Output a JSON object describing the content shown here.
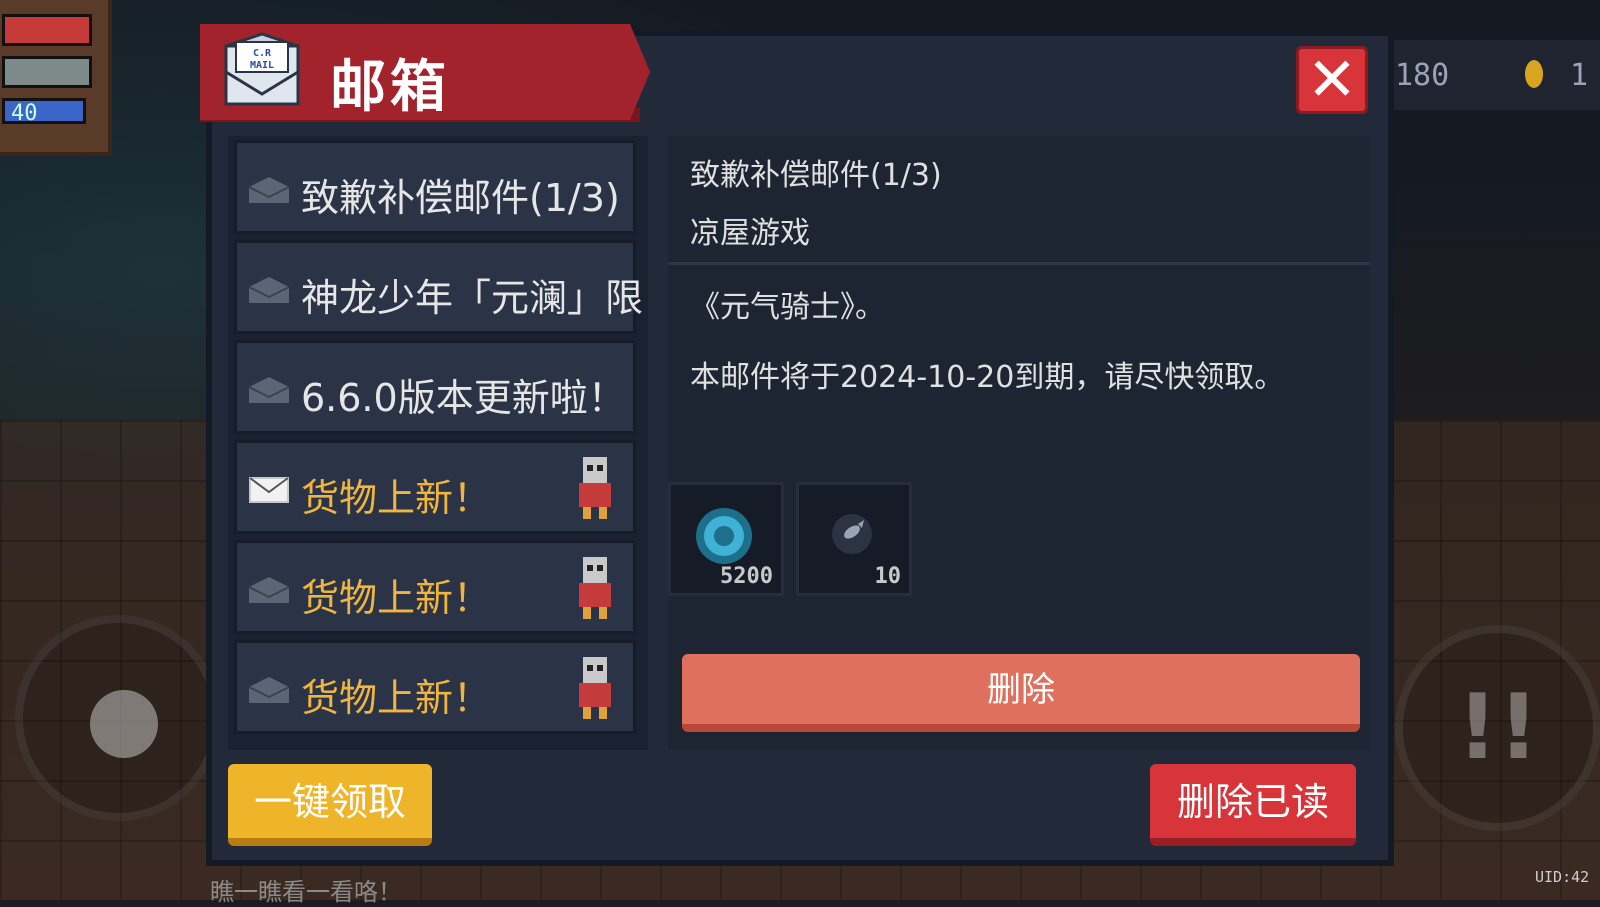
{
  "hud": {
    "energy": "40",
    "gems": "180",
    "coins": "1"
  },
  "mailbox": {
    "title": "邮箱",
    "mail_icon_text": "C.R MAIL",
    "close_label": "✕",
    "list": [
      {
        "label": "致歉补偿邮件(1/3)",
        "read": true,
        "gold": false,
        "has_avatar": false
      },
      {
        "label": "神龙少年「元澜」限",
        "read": true,
        "gold": false,
        "has_avatar": false
      },
      {
        "label": "6.6.0版本更新啦！",
        "read": true,
        "gold": false,
        "has_avatar": false
      },
      {
        "label": "货物上新！",
        "read": false,
        "gold": true,
        "has_avatar": true
      },
      {
        "label": "货物上新！",
        "read": true,
        "gold": true,
        "has_avatar": true
      },
      {
        "label": "货物上新！",
        "read": true,
        "gold": true,
        "has_avatar": true
      }
    ],
    "detail": {
      "title": "致歉补偿邮件(1/3)",
      "sender": "凉屋游戏",
      "body": "《元气骑士》。",
      "expire": "本邮件将于2024-10-20到期，请尽快领取。",
      "rewards": [
        {
          "icon": "gem-icon",
          "count": "5200"
        },
        {
          "icon": "fish-icon",
          "count": "10"
        }
      ],
      "delete_label": "删除"
    },
    "claim_all_label": "一键领取",
    "delete_read_label": "删除已读"
  },
  "chat_text": "瞧一瞧看一看咯！",
  "uid_label": "UID:42",
  "colors": {
    "panel": "#222a39",
    "title_banner": "#a3232c",
    "close": "#d8353b",
    "claim": "#eeb52a",
    "delete": "#e0705e",
    "gold_text": "#f0b540"
  }
}
